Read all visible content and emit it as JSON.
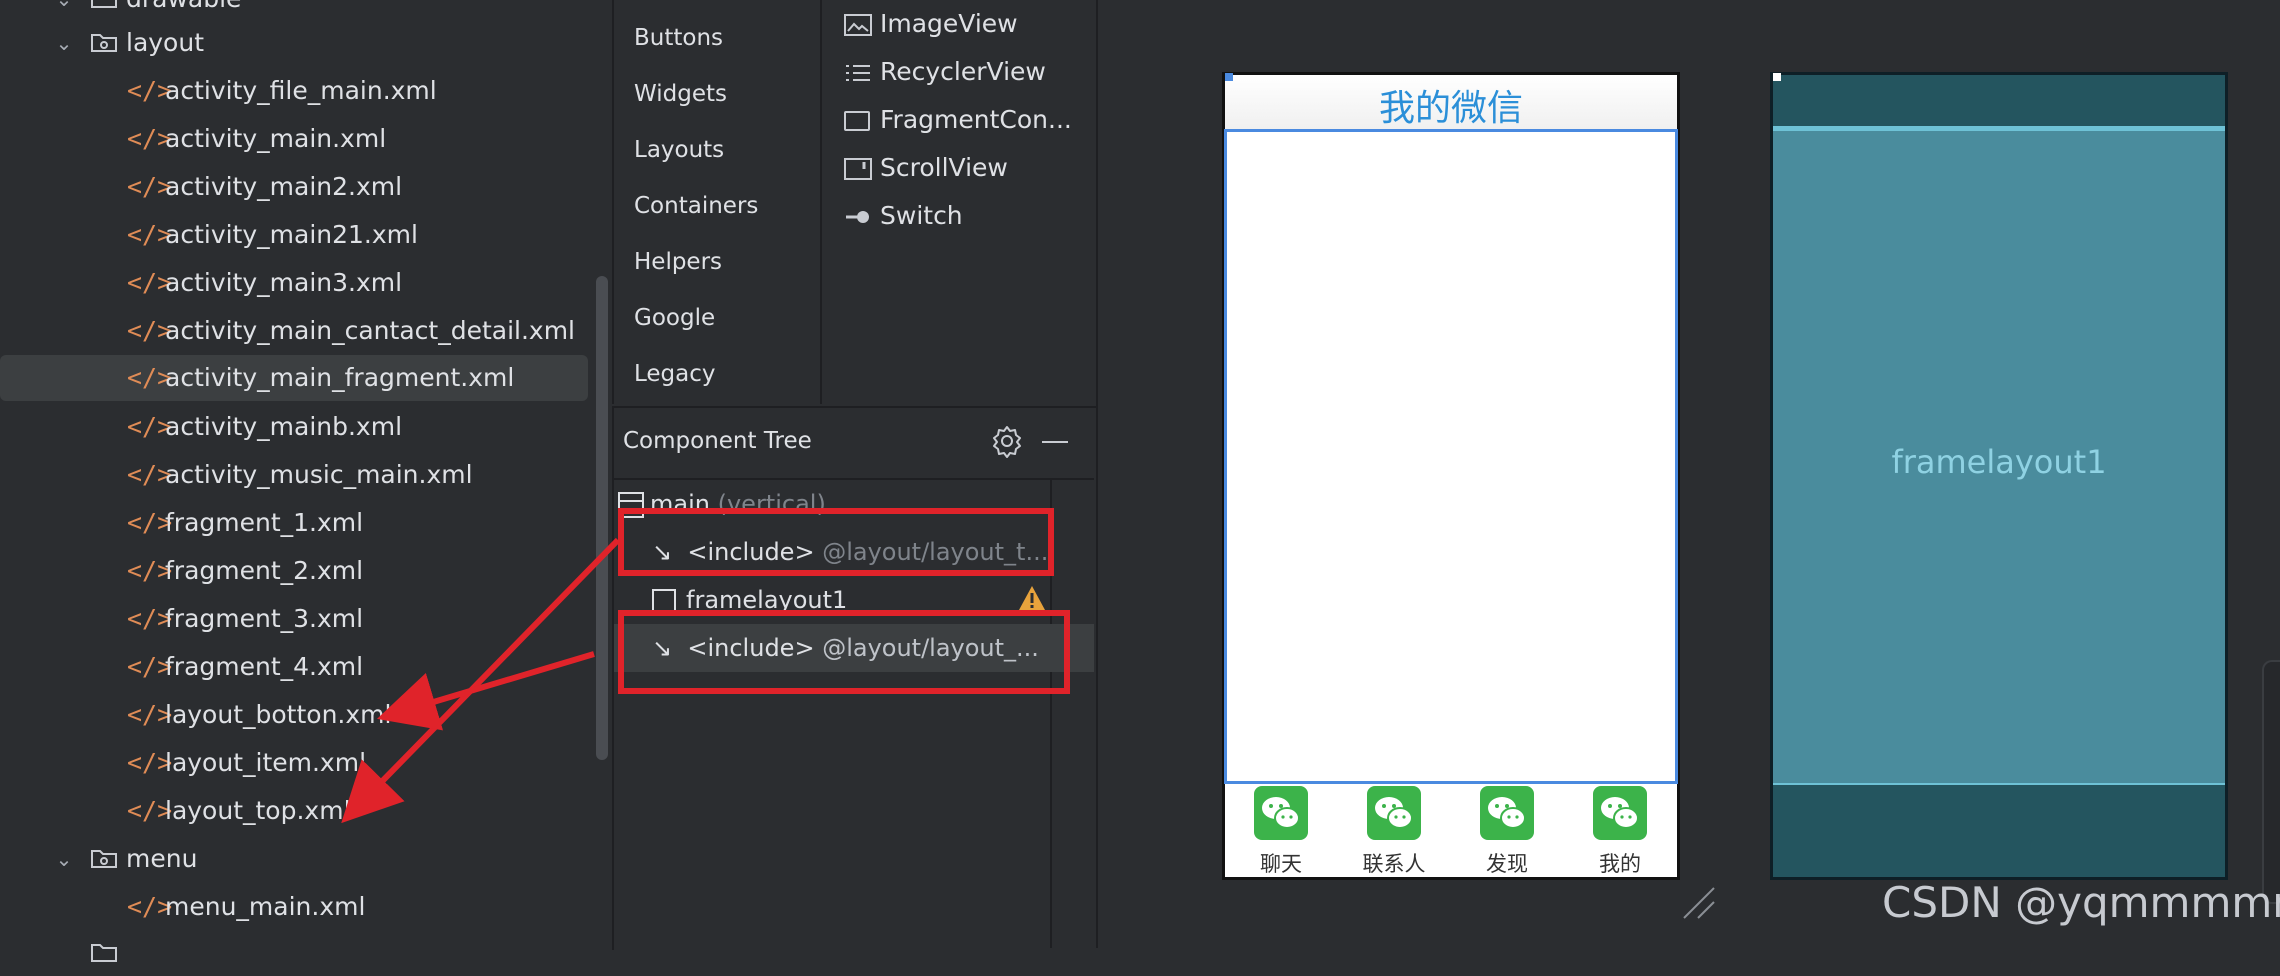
{
  "project_tree": {
    "rows": [
      {
        "type": "folder",
        "label": "drawable",
        "indent": 0
      },
      {
        "type": "folder",
        "label": "layout",
        "indent": 0
      },
      {
        "type": "file",
        "label": "activity_file_main.xml"
      },
      {
        "type": "file",
        "label": "activity_main.xml"
      },
      {
        "type": "file",
        "label": "activity_main2.xml"
      },
      {
        "type": "file",
        "label": "activity_main21.xml"
      },
      {
        "type": "file",
        "label": "activity_main3.xml"
      },
      {
        "type": "file",
        "label": "activity_main_cantact_detail.xml"
      },
      {
        "type": "file",
        "label": "activity_main_fragment.xml",
        "selected": true
      },
      {
        "type": "file",
        "label": "activity_mainb.xml"
      },
      {
        "type": "file",
        "label": "activity_music_main.xml"
      },
      {
        "type": "file",
        "label": "fragment_1.xml"
      },
      {
        "type": "file",
        "label": "fragment_2.xml"
      },
      {
        "type": "file",
        "label": "fragment_3.xml"
      },
      {
        "type": "file",
        "label": "fragment_4.xml"
      },
      {
        "type": "file",
        "label": "layout_botton.xml"
      },
      {
        "type": "file",
        "label": "layout_item.xml"
      },
      {
        "type": "file",
        "label": "layout_top.xml"
      },
      {
        "type": "folder",
        "label": "menu",
        "indent": 0
      },
      {
        "type": "file",
        "label": "menu_main.xml"
      }
    ]
  },
  "palette": {
    "categories": [
      "Buttons",
      "Widgets",
      "Layouts",
      "Containers",
      "Helpers",
      "Google",
      "Legacy"
    ],
    "items": [
      {
        "icon": "image-view-icon",
        "label": "ImageView"
      },
      {
        "icon": "list-icon",
        "label": "RecyclerView"
      },
      {
        "icon": "fragment-icon",
        "label": "FragmentCon..."
      },
      {
        "icon": "scrollview-icon",
        "label": "ScrollView"
      },
      {
        "icon": "switch-icon",
        "label": "Switch"
      }
    ]
  },
  "component_tree": {
    "title": "Component Tree",
    "root": {
      "label": "main",
      "hint": "(vertical)"
    },
    "include1": {
      "tag": "<include>",
      "ref": "@layout/layout_t..."
    },
    "frame": {
      "label": "framelayout1"
    },
    "include2": {
      "tag": "<include>",
      "ref": "@layout/layout_..."
    }
  },
  "preview": {
    "title": "我的微信",
    "tabs": [
      "聊天",
      "联系人",
      "发现",
      "我的"
    ],
    "blueprint_label": "framelayout1"
  },
  "watermark": "CSDN @yqmmmmm",
  "colors": {
    "annotation_red": "#e0232a",
    "wechat_green": "#3cb34a",
    "title_blue": "#2b8fd8",
    "blueprint": "#4a8c9d"
  }
}
